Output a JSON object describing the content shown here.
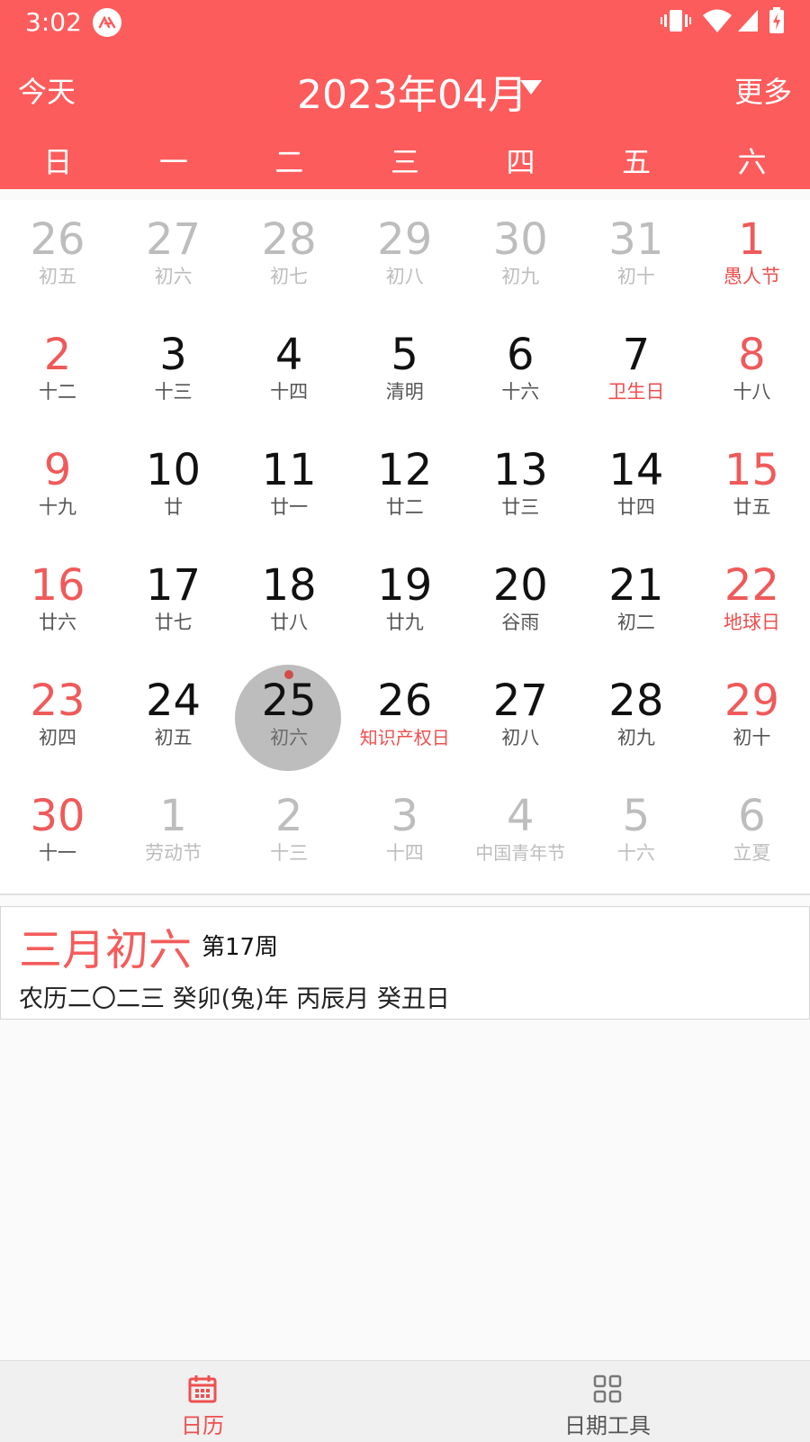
{
  "status_bar": {
    "time": "3:02"
  },
  "header": {
    "today_label": "今天",
    "month_title": "2023年04月",
    "more_label": "更多",
    "weekdays": [
      "日",
      "一",
      "二",
      "三",
      "四",
      "五",
      "六"
    ]
  },
  "colors": {
    "accent": "#fd5c5c",
    "weekend": "#ef5a5a",
    "festival": "#ef4f4f",
    "muted": "#bdbdbd",
    "text": "#111111"
  },
  "calendar": {
    "selected_index": 30,
    "days": [
      {
        "num": "26",
        "sub": "初五",
        "muted": true
      },
      {
        "num": "27",
        "sub": "初六",
        "muted": true
      },
      {
        "num": "28",
        "sub": "初七",
        "muted": true
      },
      {
        "num": "29",
        "sub": "初八",
        "muted": true
      },
      {
        "num": "30",
        "sub": "初九",
        "muted": true
      },
      {
        "num": "31",
        "sub": "初十",
        "muted": true
      },
      {
        "num": "1",
        "sub": "愚人节",
        "weekend": true,
        "festival": true
      },
      {
        "num": "2",
        "sub": "十二",
        "weekend": true
      },
      {
        "num": "3",
        "sub": "十三"
      },
      {
        "num": "4",
        "sub": "十四"
      },
      {
        "num": "5",
        "sub": "清明"
      },
      {
        "num": "6",
        "sub": "十六"
      },
      {
        "num": "7",
        "sub": "卫生日",
        "festival": true
      },
      {
        "num": "8",
        "sub": "十八",
        "weekend": true
      },
      {
        "num": "9",
        "sub": "十九",
        "weekend": true
      },
      {
        "num": "10",
        "sub": "廿"
      },
      {
        "num": "11",
        "sub": "廿一"
      },
      {
        "num": "12",
        "sub": "廿二"
      },
      {
        "num": "13",
        "sub": "廿三"
      },
      {
        "num": "14",
        "sub": "廿四"
      },
      {
        "num": "15",
        "sub": "廿五",
        "weekend": true
      },
      {
        "num": "16",
        "sub": "廿六",
        "weekend": true
      },
      {
        "num": "17",
        "sub": "廿七"
      },
      {
        "num": "18",
        "sub": "廿八"
      },
      {
        "num": "19",
        "sub": "廿九"
      },
      {
        "num": "20",
        "sub": "谷雨"
      },
      {
        "num": "21",
        "sub": "初二"
      },
      {
        "num": "22",
        "sub": "地球日",
        "weekend": true,
        "festival": true
      },
      {
        "num": "23",
        "sub": "初四",
        "weekend": true
      },
      {
        "num": "24",
        "sub": "初五"
      },
      {
        "num": "25",
        "sub": "初六",
        "selected": true
      },
      {
        "num": "26",
        "sub": "知识产权日",
        "festival": true
      },
      {
        "num": "27",
        "sub": "初八"
      },
      {
        "num": "28",
        "sub": "初九"
      },
      {
        "num": "29",
        "sub": "初十",
        "weekend": true
      },
      {
        "num": "30",
        "sub": "十一",
        "weekend": true
      },
      {
        "num": "1",
        "sub": "劳动节",
        "muted": true
      },
      {
        "num": "2",
        "sub": "十三",
        "muted": true
      },
      {
        "num": "3",
        "sub": "十四",
        "muted": true
      },
      {
        "num": "4",
        "sub": "中国青年节",
        "muted": true
      },
      {
        "num": "5",
        "sub": "十六",
        "muted": true
      },
      {
        "num": "6",
        "sub": "立夏",
        "muted": true
      }
    ]
  },
  "info": {
    "lunar_date": "三月初六",
    "week_number": "第17周",
    "ganzhi": "农历二〇二三 癸卯(兔)年 丙辰月 癸丑日"
  },
  "bottom_nav": {
    "tabs": [
      {
        "label": "日历",
        "icon": "calendar-icon",
        "active": true
      },
      {
        "label": "日期工具",
        "icon": "grid-icon",
        "active": false
      }
    ]
  }
}
